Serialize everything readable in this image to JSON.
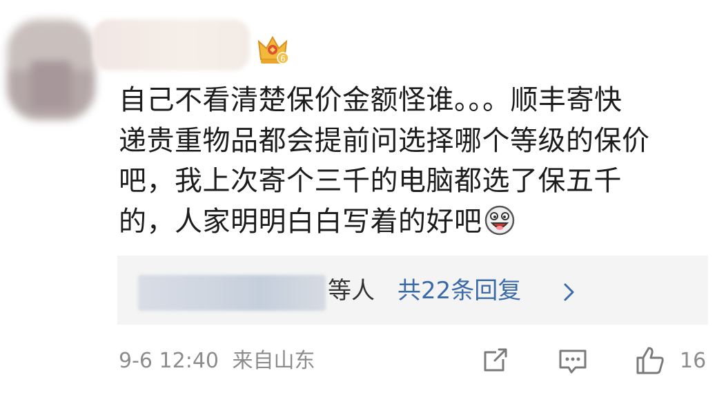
{
  "comment": {
    "lines": [
      "自己不看清楚保价金额怪谁。。。顺丰寄快",
      "递贵重物品都会提前问选择哪个等级的保价",
      "吧，我上次寄个三千的电脑都选了保五千",
      "的，人家明明白白写着的好吧"
    ],
    "emoji": "laughing-face-emoji"
  },
  "user": {
    "badge_level": "6",
    "badge_icon": "crown-icon"
  },
  "replies": {
    "suffix": "等人",
    "count_label": "共22条回复",
    "arrow": ">"
  },
  "meta": {
    "timestamp": "9-6 12:40",
    "location": "来自山东"
  },
  "actions": {
    "like_count": "16"
  },
  "colors": {
    "link": "#3a6aa8",
    "meta": "#8c8c8c",
    "reply_bg": "#f4f4f4"
  }
}
